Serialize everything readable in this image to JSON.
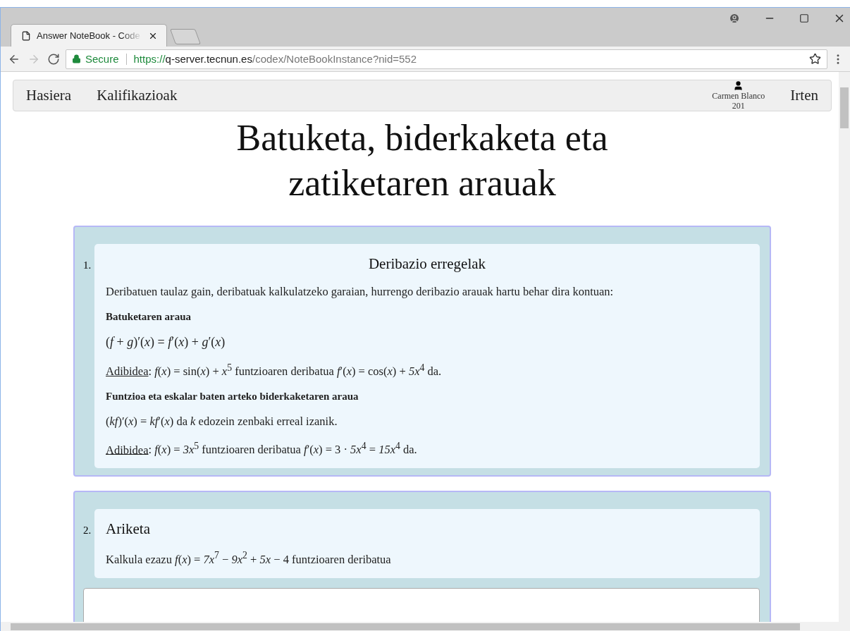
{
  "browser": {
    "tab_title": "Answer NoteBook - Code",
    "nav_buttons": [
      {
        "kind": "back",
        "disabled": false
      },
      {
        "kind": "forward",
        "disabled": true
      },
      {
        "kind": "reload",
        "disabled": false
      }
    ],
    "address": {
      "secure_label": "Secure",
      "scheme": "https://",
      "host": "q-server.tecnun.es",
      "path": "/codex/NoteBookInstance?nid=552"
    }
  },
  "navbar": {
    "items": [
      {
        "label": "Hasiera"
      },
      {
        "label": "Kalifikazioak"
      }
    ],
    "user": {
      "name": "Carmen Blanco",
      "id": "201"
    },
    "logout": "Irten"
  },
  "title": "Batuketa, biderkaketa eta zatiketaren arauak",
  "cards": [
    {
      "number": "1.",
      "heading": "Deribazio erregelak",
      "centered": true,
      "has_answer": false,
      "paragraphs": [
        {
          "kind": "text",
          "text": "Deribatuen taulaz gain, deribatuak kalkulatzeko garaian, hurrengo deribazio arauak hartu behar dira kontuan:"
        },
        {
          "kind": "heading",
          "text": "Batuketaren araua"
        },
        {
          "kind": "formula",
          "text": "(*f* + *g*)′(*x*) = *f*′(*x*) + *g*′(*x*)"
        },
        {
          "kind": "example",
          "link": "Adibidea",
          "text": ":  *f*(*x*) = sin(*x*) + *x*$^{5}$  funtzioaren deribatua  *f*′(*x*) = cos(*x*) + *5x*$^{4}$  da."
        },
        {
          "kind": "heading",
          "text": "Funtzioa eta eskalar baten arteko biderkaketaren araua"
        },
        {
          "kind": "text",
          "text": "(*kf*)′(*x*) = *kf*′(*x*)  da *k* edozein zenbaki erreal izanik."
        },
        {
          "kind": "example",
          "link": "Adibidea",
          "text": ":  *f*(*x*) = *3x*$^{5}$   funtzioaren deribatua  *f*′(*x*) = 3 · *5x*$^{4}$ = *15x*$^{4}$  da."
        }
      ]
    },
    {
      "number": "2.",
      "heading": "Ariketa",
      "centered": false,
      "has_answer": true,
      "paragraphs": [
        {
          "kind": "text",
          "text": "Kalkula ezazu  *f*(*x*) = *7x*$^{7}$ − *9x*$^{2}$ + *5x* − 4  funtzioaren deribatua"
        }
      ]
    }
  ]
}
